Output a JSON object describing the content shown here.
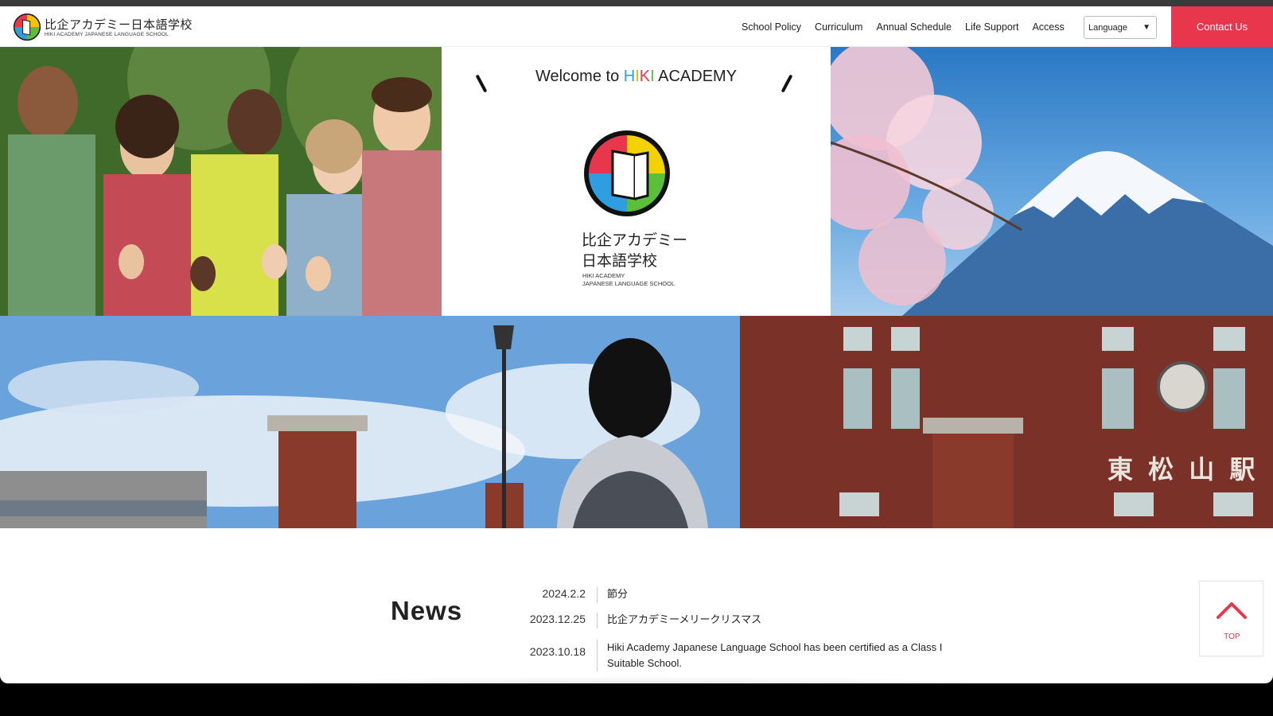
{
  "brand": {
    "name_jp": "比企アカデミー日本語学校",
    "name_en": "HIKI ACADEMY JAPANESE LANGUAGE SCHOOL",
    "accent": "#e8374d"
  },
  "nav": {
    "items": [
      "School Policy",
      "Curriculum",
      "Annual Schedule",
      "Life Support",
      "Access"
    ],
    "language_select": "Language",
    "contact": "Contact Us"
  },
  "hero": {
    "welcome_prefix": "Welcome to ",
    "welcome_letters": [
      "H",
      "I",
      "K",
      "I"
    ],
    "welcome_suffix": " ACADEMY",
    "logo_jp_line1": "比企アカデミー",
    "logo_jp_line2": "日本語学校",
    "logo_en_line1": "HIKI ACADEMY",
    "logo_en_line2": "JAPANESE LANGUAGE SCHOOL",
    "station_sign": "東 松 山 駅"
  },
  "news": {
    "heading": "News",
    "items": [
      {
        "date": "2024.2.2",
        "title": "節分"
      },
      {
        "date": "2023.12.25",
        "title": "比企アカデミーメリークリスマス"
      },
      {
        "date": "2023.10.18",
        "title": "Hiki Academy Japanese Language School has been certified as a Class I Suitable School."
      }
    ]
  },
  "top_button": {
    "label": "TOP",
    "icon": "chevron-up-icon"
  }
}
